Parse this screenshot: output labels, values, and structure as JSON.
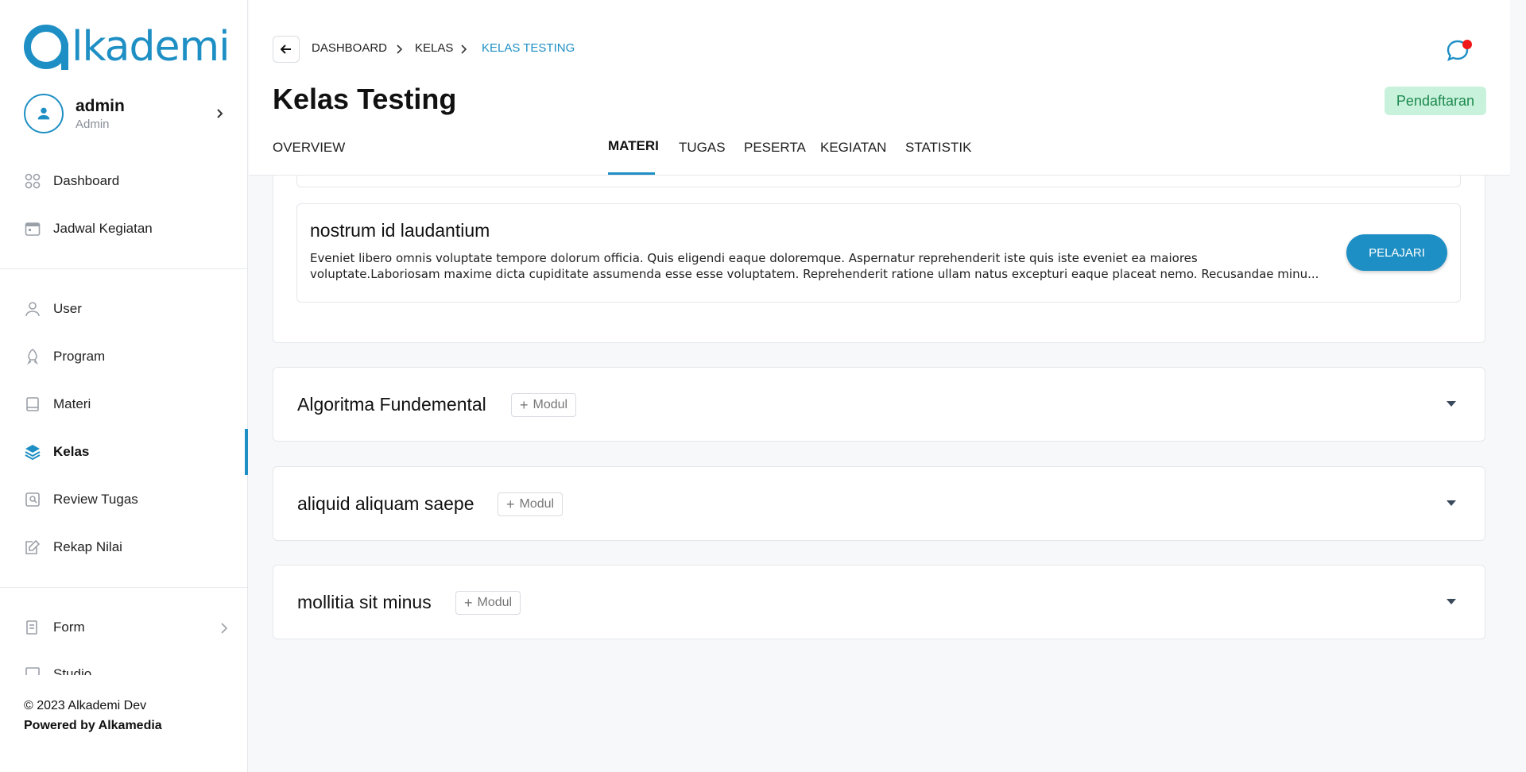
{
  "app": {
    "logo_text": "lkademi"
  },
  "profile": {
    "name": "admin",
    "role": "Admin"
  },
  "sidebar": {
    "items": [
      {
        "label": "Dashboard",
        "icon": "dashboard-icon"
      },
      {
        "label": "Jadwal Kegiatan",
        "icon": "calendar-icon"
      },
      {
        "label": "User",
        "icon": "user-icon"
      },
      {
        "label": "Program",
        "icon": "rocket-icon"
      },
      {
        "label": "Materi",
        "icon": "book-icon"
      },
      {
        "label": "Kelas",
        "icon": "layers-icon",
        "active": true
      },
      {
        "label": "Review Tugas",
        "icon": "review-icon"
      },
      {
        "label": "Rekap Nilai",
        "icon": "edit-icon"
      },
      {
        "label": "Form",
        "icon": "form-icon"
      },
      {
        "label": "Studio",
        "icon": "studio-icon"
      }
    ]
  },
  "footer": {
    "copyright": "© 2023 Alkademi Dev",
    "powered": "Powered by Alkamedia"
  },
  "breadcrumb": [
    "DASHBOARD",
    "KELAS",
    "KELAS TESTING"
  ],
  "page": {
    "title": "Kelas Testing",
    "status": "Pendaftaran"
  },
  "tabs": [
    "OVERVIEW",
    "MATERI",
    "TUGAS",
    "PESERTA",
    "KEGIATAN",
    "STATISTIK"
  ],
  "active_tab": "MATERI",
  "module": {
    "title": "nostrum id laudantium",
    "description": "Eveniet libero omnis voluptate tempore dolorum officia. Quis eligendi eaque doloremque. Aspernatur reprehenderit iste quis iste eveniet ea maiores voluptate.Laboriosam maxime dicta cupiditate assumenda esse esse voluptatem. Reprehenderit ratione ullam natus excepturi eaque placeat nemo. Recusandae minu...",
    "button": "PELAJARI"
  },
  "sections": [
    {
      "title": "Algoritma Fundemental",
      "add_label": "Modul"
    },
    {
      "title": "aliquid aliquam saepe",
      "add_label": "Modul"
    },
    {
      "title": "mollitia sit minus",
      "add_label": "Modul"
    }
  ],
  "colors": {
    "accent": "#1e8fc4",
    "status_bg": "#c9f2dd",
    "status_text": "#1d8a4e",
    "notif": "#f01818"
  }
}
